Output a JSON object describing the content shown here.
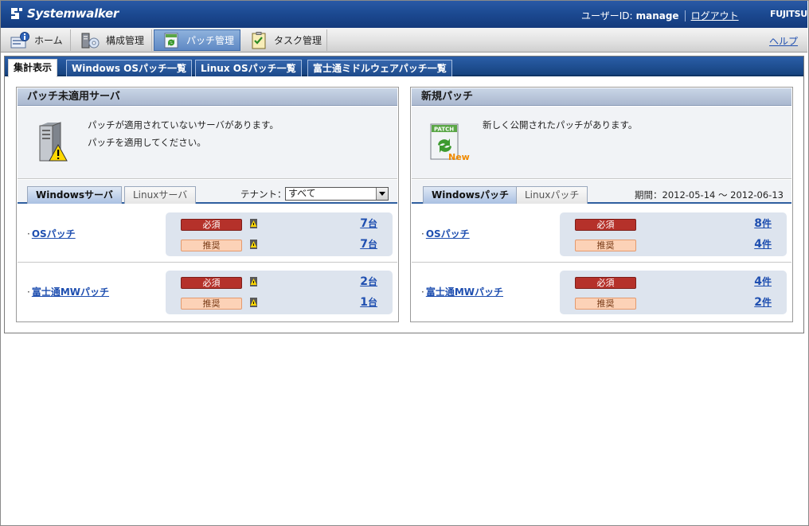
{
  "header": {
    "brand": "Systemwalker",
    "user_id_label": "ユーザーID:",
    "user_id_value": "manage",
    "logout_label": "ログアウト",
    "company": "FUJITSU"
  },
  "nav": {
    "items": [
      {
        "label": "ホーム",
        "icon": "home-info-icon"
      },
      {
        "label": "構成管理",
        "icon": "configuration-icon"
      },
      {
        "label": "パッチ管理",
        "icon": "patch-icon",
        "active": true
      },
      {
        "label": "タスク管理",
        "icon": "task-checklist-icon"
      }
    ],
    "help_label": "ヘルプ"
  },
  "tabs": [
    {
      "label": "集計表示",
      "active": true
    },
    {
      "label": "Windows OSパッチ一覧"
    },
    {
      "label": "Linux OSパッチ一覧"
    },
    {
      "label": "富士通ミドルウェアパッチ一覧"
    }
  ],
  "left_panel": {
    "title": "パッチ未適用サーバ",
    "icon": "server-warning-icon",
    "message_line1": "パッチが適用されていないサーバがあります。",
    "message_line2": "パッチを適用してください。",
    "subtabs": [
      {
        "label": "Windowsサーバ",
        "active": true
      },
      {
        "label": "Linuxサーバ"
      }
    ],
    "tenant_label": "テナント：",
    "tenant_value": "すべて",
    "rows": [
      {
        "link": "OSパッチ",
        "required_label": "必須",
        "required_count": "7",
        "recommended_label": "推奨",
        "recommended_count": "7",
        "unit": "台"
      },
      {
        "link": "富士通MWパッチ",
        "required_label": "必須",
        "required_count": "2",
        "recommended_label": "推奨",
        "recommended_count": "1",
        "unit": "台"
      }
    ]
  },
  "right_panel": {
    "title": "新規パッチ",
    "icon": "patch-new-icon",
    "icon_text_top": "PATCH",
    "icon_text_bottom": "New",
    "message_line1": "新しく公開されたパッチがあります。",
    "subtabs": [
      {
        "label": "Windowsパッチ",
        "active": true
      },
      {
        "label": "Linuxパッチ"
      }
    ],
    "period": "期間：2012-05-14 ～ 2012-06-13",
    "rows": [
      {
        "link": "OSパッチ",
        "required_label": "必須",
        "required_count": "8",
        "recommended_label": "推奨",
        "recommended_count": "4",
        "unit": "件"
      },
      {
        "link": "富士通MWパッチ",
        "required_label": "必須",
        "required_count": "4",
        "recommended_label": "推奨",
        "recommended_count": "2",
        "unit": "件"
      }
    ]
  },
  "colors": {
    "header_blue": "#1c4a92",
    "required_red": "#b5312a",
    "recommended_peach": "#fcd2b7",
    "link_blue": "#1f4fb0"
  }
}
